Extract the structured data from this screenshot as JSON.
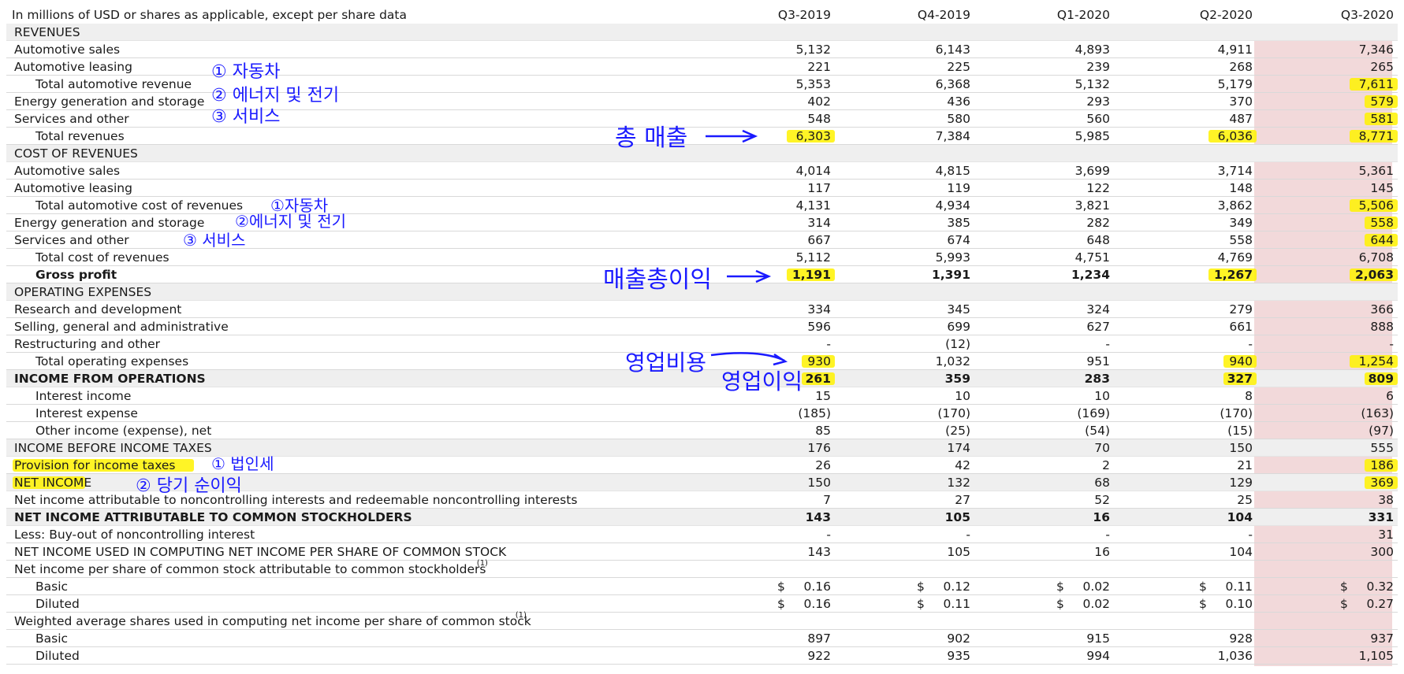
{
  "header": {
    "caption": "In millions of USD or shares as applicable, except per share data",
    "columns": [
      "Q3-2019",
      "Q4-2019",
      "Q1-2020",
      "Q2-2020",
      "Q3-2020"
    ]
  },
  "rows": [
    {
      "label": "REVENUES",
      "kind": "section",
      "values": [
        "",
        "",
        "",
        "",
        ""
      ]
    },
    {
      "label": "Automotive sales",
      "kind": "normal",
      "values": [
        "5,132",
        "6,143",
        "4,893",
        "4,911",
        "7,346"
      ]
    },
    {
      "label": "Automotive leasing",
      "kind": "normal",
      "values": [
        "221",
        "225",
        "239",
        "268",
        "265"
      ]
    },
    {
      "label": "Total automotive revenue",
      "kind": "indent",
      "values": [
        "5,353",
        "6,368",
        "5,132",
        "5,179",
        "7,611"
      ]
    },
    {
      "label": "Energy generation and storage",
      "kind": "normal",
      "values": [
        "402",
        "436",
        "293",
        "370",
        "579"
      ]
    },
    {
      "label": "Services and other",
      "kind": "normal",
      "values": [
        "548",
        "580",
        "560",
        "487",
        "581"
      ]
    },
    {
      "label": "Total revenues",
      "kind": "indent",
      "values": [
        "6,303",
        "7,384",
        "5,985",
        "6,036",
        "8,771"
      ]
    },
    {
      "label": "COST OF REVENUES",
      "kind": "section",
      "values": [
        "",
        "",
        "",
        "",
        ""
      ]
    },
    {
      "label": "Automotive sales",
      "kind": "normal",
      "values": [
        "4,014",
        "4,815",
        "3,699",
        "3,714",
        "5,361"
      ]
    },
    {
      "label": "Automotive leasing",
      "kind": "normal",
      "values": [
        "117",
        "119",
        "122",
        "148",
        "145"
      ]
    },
    {
      "label": "Total automotive cost of revenues",
      "kind": "indent",
      "values": [
        "4,131",
        "4,934",
        "3,821",
        "3,862",
        "5,506"
      ]
    },
    {
      "label": "Energy generation and storage",
      "kind": "normal",
      "values": [
        "314",
        "385",
        "282",
        "349",
        "558"
      ]
    },
    {
      "label": "Services and other",
      "kind": "normal",
      "values": [
        "667",
        "674",
        "648",
        "558",
        "644"
      ]
    },
    {
      "label": "Total cost of revenues",
      "kind": "indent",
      "values": [
        "5,112",
        "5,993",
        "4,751",
        "4,769",
        "6,708"
      ]
    },
    {
      "label": "Gross profit",
      "kind": "indent-bold",
      "values": [
        "1,191",
        "1,391",
        "1,234",
        "1,267",
        "2,063"
      ]
    },
    {
      "label": "OPERATING EXPENSES",
      "kind": "section",
      "values": [
        "",
        "",
        "",
        "",
        ""
      ]
    },
    {
      "label": "Research and development",
      "kind": "normal",
      "values": [
        "334",
        "345",
        "324",
        "279",
        "366"
      ]
    },
    {
      "label": "Selling, general and administrative",
      "kind": "normal",
      "values": [
        "596",
        "699",
        "627",
        "661",
        "888"
      ]
    },
    {
      "label": "Restructuring and other",
      "kind": "normal",
      "values": [
        "-",
        "(12)",
        "-",
        "-",
        "-"
      ]
    },
    {
      "label": "Total operating expenses",
      "kind": "indent",
      "values": [
        "930",
        "1,032",
        "951",
        "940",
        "1,254"
      ]
    },
    {
      "label": "INCOME FROM OPERATIONS",
      "kind": "section-bold",
      "values": [
        "261",
        "359",
        "283",
        "327",
        "809"
      ]
    },
    {
      "label": "Interest income",
      "kind": "indent",
      "values": [
        "15",
        "10",
        "10",
        "8",
        "6"
      ]
    },
    {
      "label": "Interest expense",
      "kind": "indent",
      "values": [
        "(185)",
        "(170)",
        "(169)",
        "(170)",
        "(163)"
      ]
    },
    {
      "label": "Other income (expense), net",
      "kind": "indent",
      "values": [
        "85",
        "(25)",
        "(54)",
        "(15)",
        "(97)"
      ]
    },
    {
      "label": "INCOME BEFORE INCOME TAXES",
      "kind": "section",
      "values": [
        "176",
        "174",
        "70",
        "150",
        "555"
      ]
    },
    {
      "label": "Provision for income taxes",
      "kind": "normal",
      "values": [
        "26",
        "42",
        "2",
        "21",
        "186"
      ]
    },
    {
      "label": "NET INCOME",
      "kind": "section",
      "values": [
        "150",
        "132",
        "68",
        "129",
        "369"
      ]
    },
    {
      "label": "Net income attributable to noncontrolling interests and redeemable noncontrolling interests",
      "kind": "normal",
      "values": [
        "7",
        "27",
        "52",
        "25",
        "38"
      ]
    },
    {
      "label": "NET INCOME ATTRIBUTABLE TO COMMON STOCKHOLDERS",
      "kind": "section-bold",
      "values": [
        "143",
        "105",
        "16",
        "104",
        "331"
      ]
    },
    {
      "label": "Less: Buy-out of noncontrolling interest",
      "kind": "normal",
      "values": [
        "-",
        "-",
        "-",
        "-",
        "31"
      ]
    },
    {
      "label": "NET INCOME USED IN COMPUTING NET INCOME PER SHARE OF COMMON STOCK",
      "kind": "normal",
      "values": [
        "143",
        "105",
        "16",
        "104",
        "300"
      ]
    },
    {
      "label": "Net income per share of common stock attributable to common stockholders",
      "sup": "(1)",
      "kind": "normal",
      "values": [
        "",
        "",
        "",
        "",
        ""
      ]
    },
    {
      "label": "Basic",
      "kind": "indent-dollar",
      "values": [
        "0.16",
        "0.12",
        "0.02",
        "0.11",
        "0.32"
      ]
    },
    {
      "label": "Diluted",
      "kind": "indent-dollar",
      "values": [
        "0.16",
        "0.11",
        "0.02",
        "0.10",
        "0.27"
      ]
    },
    {
      "label": "Weighted average shares used in computing net income per share of common stock",
      "sup": "(1)",
      "kind": "normal",
      "values": [
        "",
        "",
        "",
        "",
        ""
      ]
    },
    {
      "label": "Basic",
      "kind": "indent",
      "values": [
        "897",
        "902",
        "915",
        "928",
        "937"
      ]
    },
    {
      "label": "Diluted",
      "kind": "indent",
      "values": [
        "922",
        "935",
        "994",
        "1,036",
        "1,105"
      ]
    }
  ],
  "currency_symbol": "$",
  "highlights": [
    {
      "row": 3,
      "cols": [
        4
      ]
    },
    {
      "row": 4,
      "cols": [
        4
      ]
    },
    {
      "row": 5,
      "cols": [
        4
      ]
    },
    {
      "row": 6,
      "cols": [
        0,
        3,
        4
      ]
    },
    {
      "row": 10,
      "cols": [
        4
      ]
    },
    {
      "row": 11,
      "cols": [
        4
      ]
    },
    {
      "row": 12,
      "cols": [
        4
      ]
    },
    {
      "row": 14,
      "cols": [
        0,
        3,
        4
      ]
    },
    {
      "row": 19,
      "cols": [
        0,
        3,
        4
      ]
    },
    {
      "row": 20,
      "cols": [
        0,
        3,
        4
      ]
    },
    {
      "row": 25,
      "cols": [
        4,
        "label"
      ]
    },
    {
      "row": 26,
      "cols": [
        4,
        "label"
      ]
    }
  ],
  "annotations": {
    "rev_1": "① 자동차",
    "rev_2": "② 에너지 및 전기",
    "rev_3": "③ 서비스",
    "total_revenue": "총 매출",
    "cost_1": "①자동차",
    "cost_2": "②에너지 및 전기",
    "cost_3": "③ 서비스",
    "gross_profit": "매출총이익",
    "opex": "영업비용",
    "op_income": "영업이익",
    "tax_1": "① 법인세",
    "tax_2": "② 당기 순이익"
  },
  "colors": {
    "ink": "#1a1aff",
    "highlight": "#fff200",
    "column_tint": "#f2d9da",
    "section_bg": "#efefef"
  }
}
